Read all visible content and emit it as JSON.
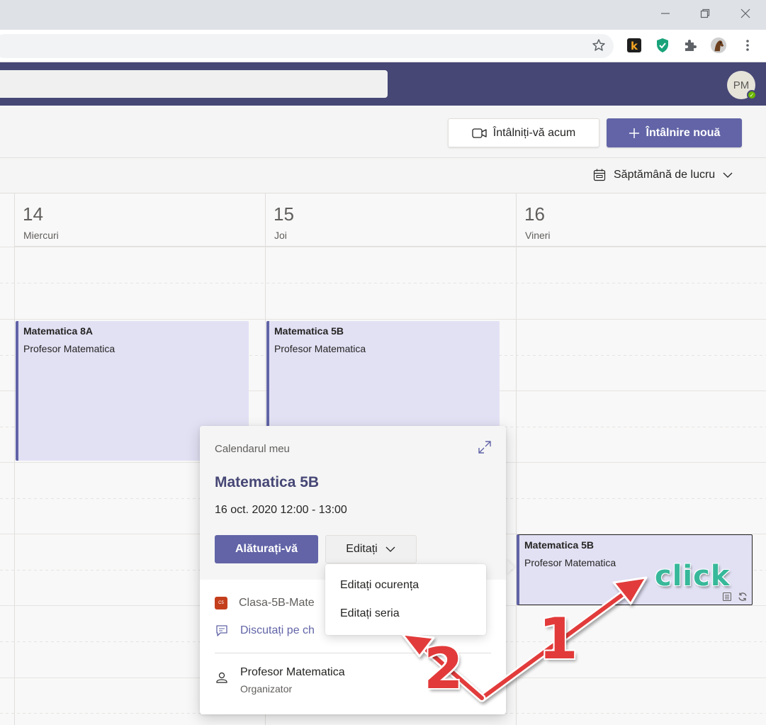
{
  "header": {
    "avatar_initials": "PM"
  },
  "toolbar": {
    "meet_now_label": "Întâlniți-vă acum",
    "new_meeting_label": "Întâlnire nouă",
    "view_label": "Săptămână de lucru"
  },
  "days": [
    {
      "num": "14",
      "name": "Miercuri"
    },
    {
      "num": "15",
      "name": "Joi"
    },
    {
      "num": "16",
      "name": "Vineri"
    }
  ],
  "events": [
    {
      "title": "Matematica 8A",
      "organizer": "Profesor Matematica"
    },
    {
      "title": "Matematica 5B",
      "organizer": "Profesor Matematica"
    },
    {
      "title": "Matematica 5B",
      "organizer": "Profesor Matematica"
    }
  ],
  "popup": {
    "calendar_label": "Calendarul meu",
    "title": "Matematica 5B",
    "time": "16 oct. 2020 12:00 - 13:00",
    "join_label": "Alăturați-vă",
    "edit_label": "Editați",
    "team_name": "Clasa-5B-Mate",
    "chat_label": "Discutați pe ch",
    "organizer_name": "Profesor Matematica",
    "organizer_role": "Organizator"
  },
  "dropdown": {
    "items": [
      "Editați ocurența",
      "Editați seria"
    ]
  },
  "annotations": {
    "click_text": "click",
    "step1": "1",
    "step2": "2"
  },
  "colors": {
    "teams_purple": "#464775",
    "accent": "#6264a7",
    "arrow_red": "#e23a3a",
    "click_green": "#37b89a"
  }
}
